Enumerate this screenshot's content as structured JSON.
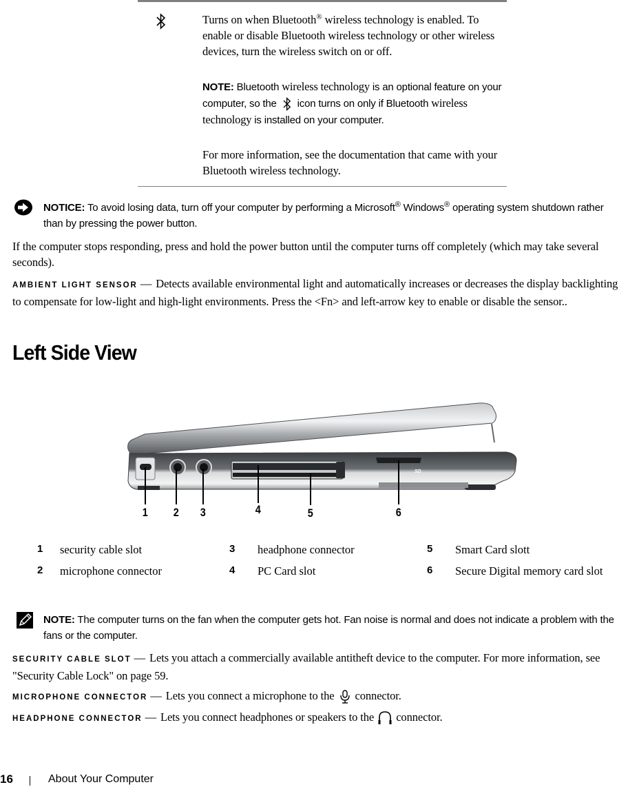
{
  "bluetooth_row": {
    "icon": "bluetooth-icon",
    "desc_part1": "Turns on when Bluetooth",
    "reg": "®",
    "desc_part2": " wireless technology is enabled. To enable or disable Bluetooth wireless technology or other wireless devices, turn the wireless switch on or off.",
    "note_label": "NOTE:",
    "note_a": " Bluetooth ",
    "note_b": "wireless technology",
    "note_c": " is an optional feature on your computer, so the ",
    "note_d": " icon turns on only if Bluetooth ",
    "note_e": "wireless technology",
    "note_f": " is installed on your computer.",
    "more_info": "For more information, see the documentation that came with your Bluetooth wireless technology."
  },
  "notice": {
    "icon": "notice-arrow-icon",
    "label": "NOTICE:",
    "text_a": " To avoid losing data, turn off your computer by performing a Microsoft",
    "reg1": "®",
    "text_b": " Windows",
    "reg2": "®",
    "text_c": " operating system shutdown rather than by pressing the power button."
  },
  "power_paragraph": "If the computer stops responding, press and hold the power button until the computer turns off completely (which may take several seconds).",
  "ambient": {
    "label": "AMBIENT LIGHT SENSOR",
    "dash": "—",
    "text": "Detects available environmental light and automatically increases or decreases the display backlighting to compensate for low-light and high-light environments. Press the <Fn> and left-arrow key to enable or disable the sensor.."
  },
  "section_title": "Left Side View",
  "figure": {
    "callouts": [
      "1",
      "2",
      "3",
      "4",
      "5",
      "6"
    ],
    "sd_logo": "SD"
  },
  "legend": [
    {
      "num": "1",
      "label": "security cable slot"
    },
    {
      "num": "2",
      "label": "microphone connector"
    },
    {
      "num": "3",
      "label": "headphone connector"
    },
    {
      "num": "4",
      "label": "PC Card slot"
    },
    {
      "num": "5",
      "label": "Smart Card slott"
    },
    {
      "num": "6",
      "label": "Secure Digital memory card slot"
    }
  ],
  "note": {
    "icon": "note-pencil-icon",
    "label": "NOTE:",
    "text": " The computer turns on the fan when the computer gets hot. Fan noise is normal and does not indicate a problem with the fans or the computer."
  },
  "descriptions": [
    {
      "label": "SECURITY CABLE SLOT",
      "dash": "—",
      "text": "Lets you attach a commercially available antitheft device to the computer. For more information, see \"Security Cable Lock\" on page 59."
    },
    {
      "label": "MICROPHONE CONNECTOR",
      "dash": "—",
      "text_a": "Lets you connect a microphone to the ",
      "icon": "microphone-icon",
      "text_b": " connector."
    },
    {
      "label": "HEADPHONE CONNECTOR",
      "dash": "—",
      "text_a": "Lets you connect headphones or speakers to the ",
      "icon": "headphone-icon",
      "text_b": " connector."
    }
  ],
  "footer": {
    "page_number": "16",
    "separator": "|",
    "chapter": "About Your Computer"
  }
}
